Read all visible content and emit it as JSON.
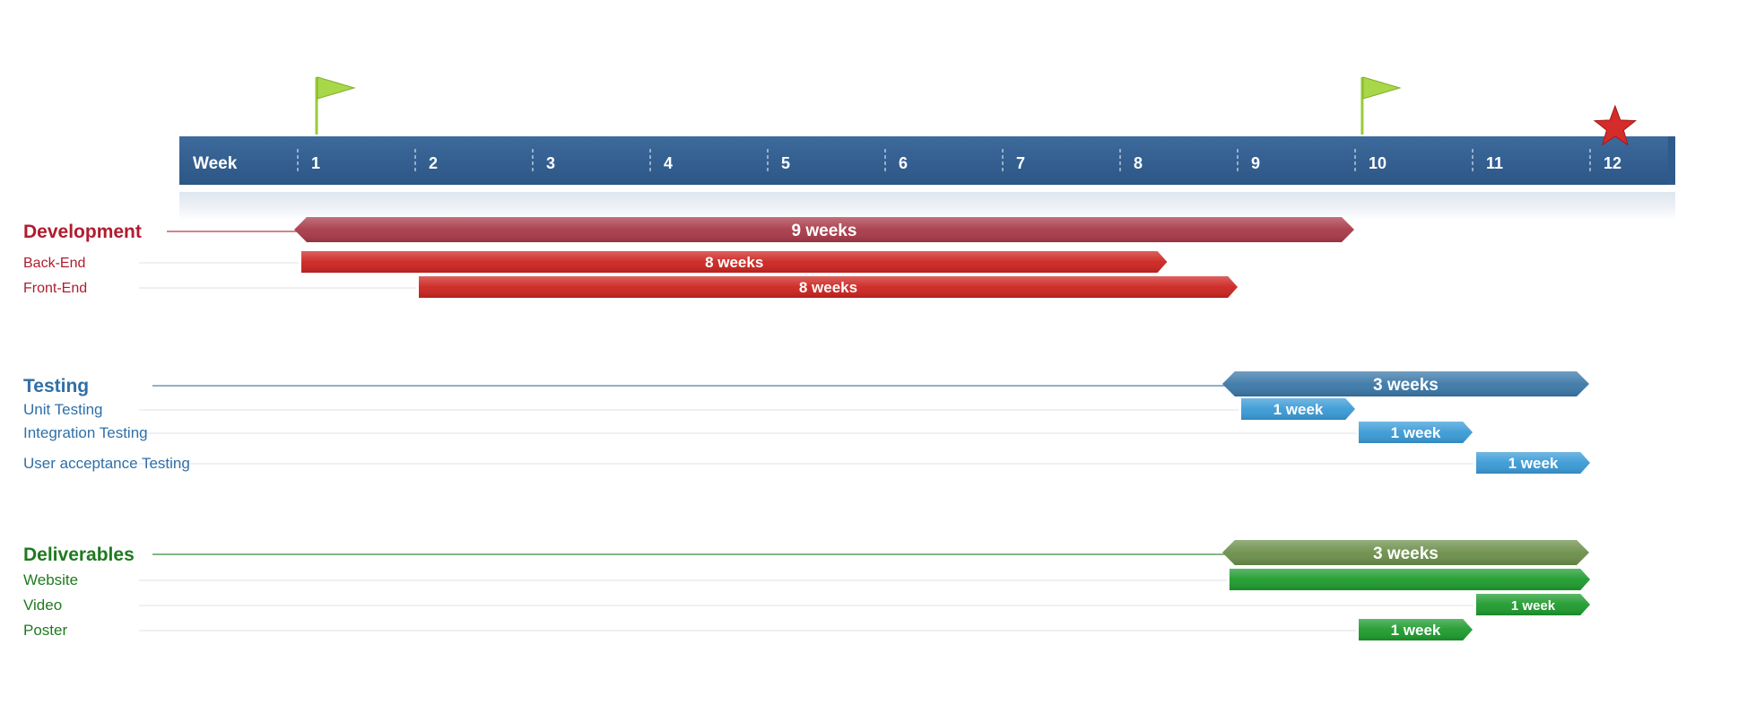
{
  "chart_data": {
    "type": "gantt",
    "axis": {
      "label": "Week",
      "ticks": [
        "1",
        "2",
        "3",
        "4",
        "5",
        "6",
        "7",
        "8",
        "9",
        "10",
        "11",
        "12"
      ]
    },
    "milestones": [
      {
        "kind": "flag",
        "week": 1
      },
      {
        "kind": "flag",
        "week": 9.9
      },
      {
        "kind": "star",
        "week": 11.9
      }
    ],
    "groups": [
      {
        "name": "Development",
        "color": "#b01c2e",
        "summary": {
          "start": 1,
          "end": 10,
          "label": "9 weeks",
          "color": "#a83a48"
        },
        "tasks": [
          {
            "name": "Back-End",
            "start": 1,
            "end": 8.4,
            "label": "8 weeks",
            "color": "#cc2420"
          },
          {
            "name": "Front-End",
            "start": 2,
            "end": 9,
            "label": "8 weeks",
            "color": "#cc2420"
          }
        ]
      },
      {
        "name": "Testing",
        "color": "#2f6fa8",
        "summary": {
          "start": 8.9,
          "end": 12,
          "label": "3 weeks",
          "color": "#3b78a8"
        },
        "tasks": [
          {
            "name": "Unit Testing",
            "start": 9,
            "end": 10,
            "label": "1 week",
            "color": "#3a9ad6"
          },
          {
            "name": "Integration Testing",
            "start": 10,
            "end": 11,
            "label": "1 week",
            "color": "#3a9ad6"
          },
          {
            "name": "User acceptance Testing",
            "start": 11,
            "end": 12,
            "label": "1 week",
            "color": "#3a9ad6"
          }
        ]
      },
      {
        "name": "Deliverables",
        "color": "#1f7a1f",
        "summary": {
          "start": 8.9,
          "end": 12,
          "label": "3 weeks",
          "color": "#6b8f4a"
        },
        "tasks": [
          {
            "name": "Website",
            "start": 8.9,
            "end": 12,
            "label": "",
            "color": "#1e9b2e"
          },
          {
            "name": "Video",
            "start": 11,
            "end": 12,
            "label": "1 week",
            "color": "#1e9b2e"
          },
          {
            "name": "Poster",
            "start": 10,
            "end": 11,
            "label": "1 week",
            "color": "#1e9b2e"
          }
        ]
      }
    ]
  }
}
